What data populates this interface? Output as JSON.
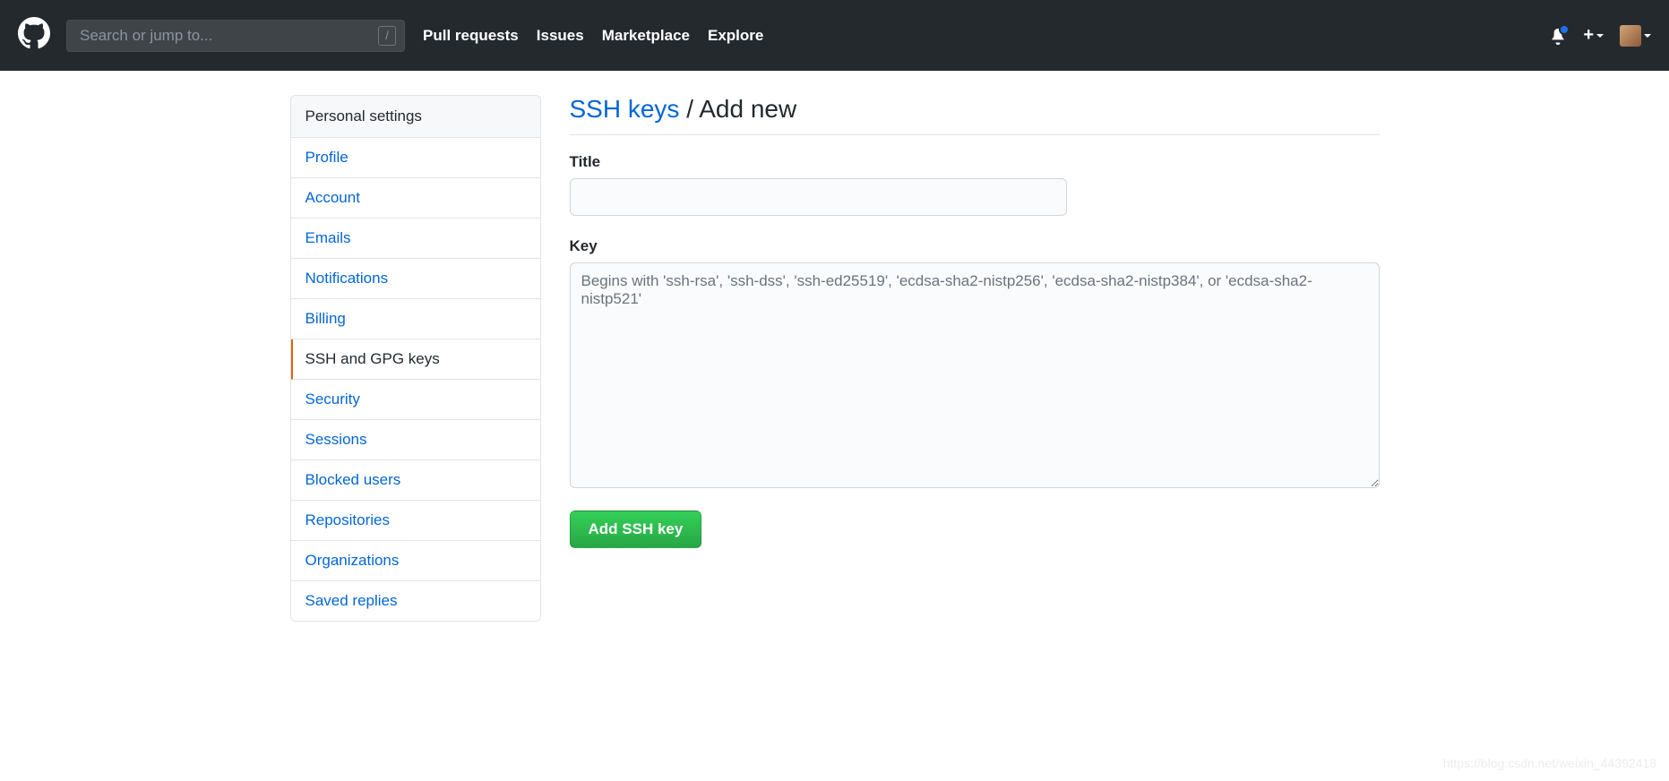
{
  "header": {
    "search_placeholder": "Search or jump to...",
    "slash_key": "/",
    "nav": [
      "Pull requests",
      "Issues",
      "Marketplace",
      "Explore"
    ]
  },
  "sidebar": {
    "title": "Personal settings",
    "items": [
      {
        "label": "Profile",
        "active": false
      },
      {
        "label": "Account",
        "active": false
      },
      {
        "label": "Emails",
        "active": false
      },
      {
        "label": "Notifications",
        "active": false
      },
      {
        "label": "Billing",
        "active": false
      },
      {
        "label": "SSH and GPG keys",
        "active": true
      },
      {
        "label": "Security",
        "active": false
      },
      {
        "label": "Sessions",
        "active": false
      },
      {
        "label": "Blocked users",
        "active": false
      },
      {
        "label": "Repositories",
        "active": false
      },
      {
        "label": "Organizations",
        "active": false
      },
      {
        "label": "Saved replies",
        "active": false
      }
    ]
  },
  "page": {
    "breadcrumb_link": "SSH keys",
    "breadcrumb_sep": " / ",
    "breadcrumb_current": "Add new",
    "title_label": "Title",
    "title_value": "",
    "key_label": "Key",
    "key_value": "",
    "key_placeholder": "Begins with 'ssh-rsa', 'ssh-dss', 'ssh-ed25519', 'ecdsa-sha2-nistp256', 'ecdsa-sha2-nistp384', or 'ecdsa-sha2-nistp521'",
    "submit_label": "Add SSH key"
  },
  "watermark": "https://blog.csdn.net/weixin_44392418"
}
